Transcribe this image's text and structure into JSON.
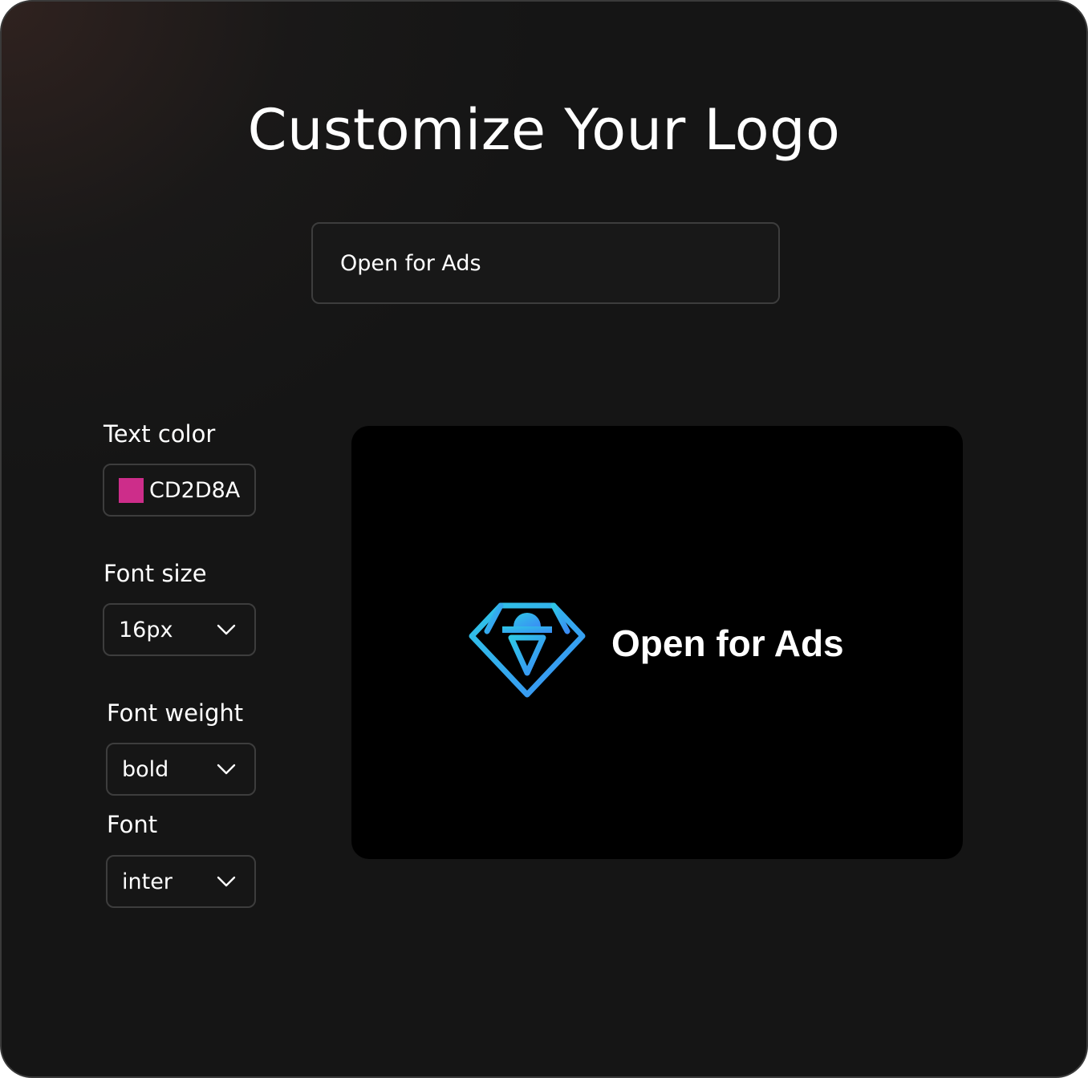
{
  "title": "Customize Your Logo",
  "logo_text_input": {
    "value": "Open for Ads"
  },
  "controls": {
    "text_color": {
      "label": "Text color",
      "value": "CD2D8A",
      "swatch": "#CD2D8A"
    },
    "font_size": {
      "label": "Font size",
      "value": "16px"
    },
    "font_weight": {
      "label": "Font weight",
      "value": "bold"
    },
    "font": {
      "label": "Font",
      "value": "inter"
    }
  },
  "preview": {
    "text": "Open for Ads",
    "icon": "diamond-icon",
    "icon_gradient": [
      "#2EC7E6",
      "#3A8DF5"
    ]
  },
  "colors": {
    "background": "#151515",
    "border": "#3d3d3d",
    "preview_background": "#000000"
  }
}
